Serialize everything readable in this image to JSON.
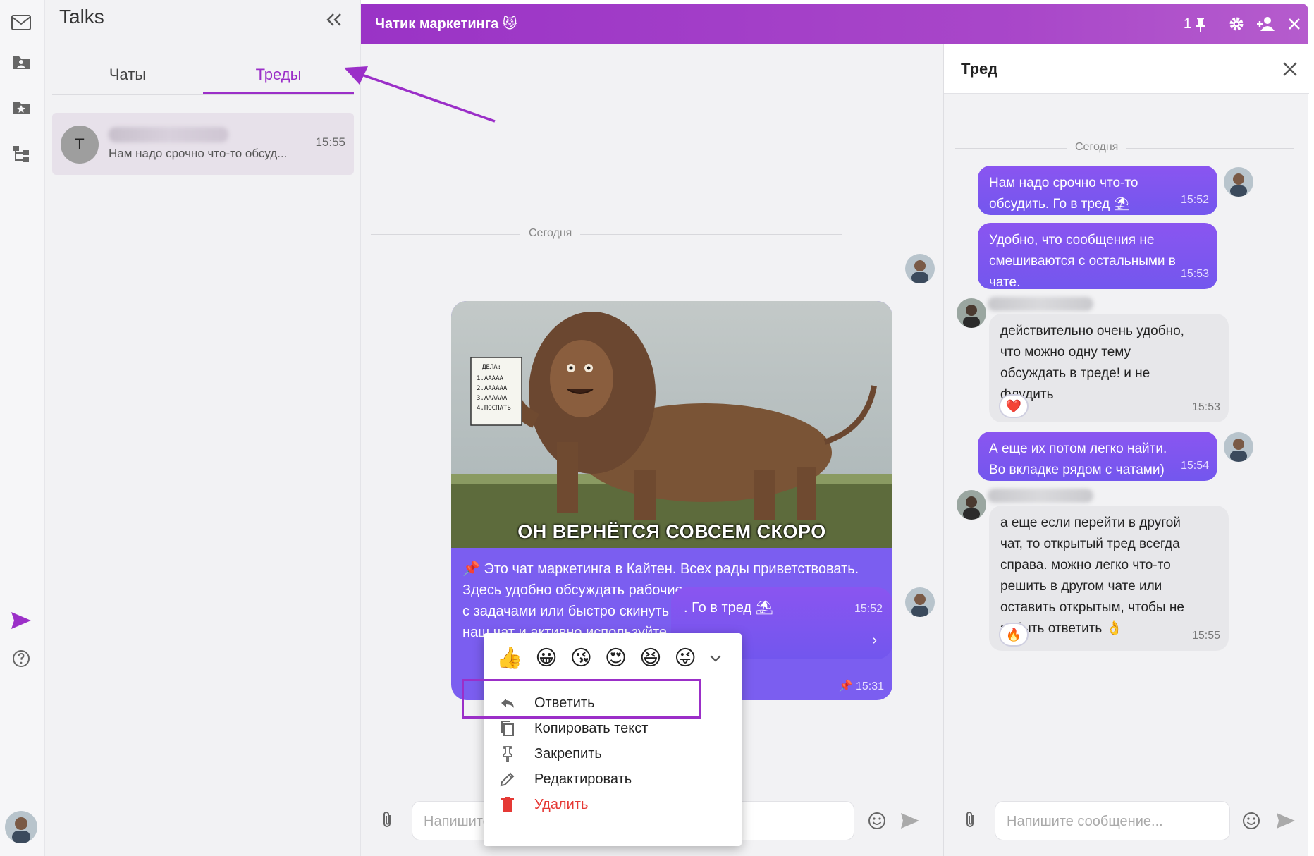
{
  "sidebar": {
    "title": "Talks",
    "tabs": [
      {
        "label": "Чаты"
      },
      {
        "label": "Треды"
      }
    ],
    "thread_item": {
      "avatar_letter": "T",
      "preview": "Нам надо срочно что-то обсуд...",
      "time": "15:55"
    }
  },
  "header": {
    "title": "Чатик маркетинга 😼",
    "pinned_count": "1"
  },
  "chat": {
    "date_label": "Сегодня",
    "meme_caption": "ОН ВЕРНЁТСЯ СОВСЕМ СКОРО",
    "note_lines": [
      "ДЕЛА:",
      "1.ААААА",
      "2.АААААА",
      "3.АААААА",
      "4.ПОСПАТЬ"
    ],
    "message1": {
      "text": "📌 Это чат маркетинга в Кайтен. Всех рады приветствовать. Здесь удобно обсуждать рабочие процессы не отходя от досок с задачами или быстро скинуть файл. Добавляйте коллег в наш чат и активно используйте",
      "time": "15:31"
    },
    "message2": {
      "text": ". Го в тред ⛱",
      "time": "15:52"
    },
    "input_placeholder": "Напишите сообщение..."
  },
  "context_menu": {
    "emojis": [
      "👍",
      "😀",
      "😘",
      "😍",
      "😆",
      "😜"
    ],
    "items": [
      {
        "label": "Ответить"
      },
      {
        "label": "Копировать текст"
      },
      {
        "label": "Закрепить"
      },
      {
        "label": "Редактировать"
      },
      {
        "label": "Удалить"
      }
    ]
  },
  "thread": {
    "title": "Тред",
    "date_label": "Сегодня",
    "messages": [
      {
        "text": "Нам надо срочно что-то обсудить. Го в тред ⛱",
        "time": "15:52"
      },
      {
        "text": "Удобно, что сообщения не смешиваются с остальными в чате.",
        "time": "15:53"
      },
      {
        "text": "действительно очень удобно, что можно одну тему обсуждать в треде! и не флудить",
        "time": "15:53",
        "reaction": "❤️"
      },
      {
        "text": "А еще их потом легко найти. Во вкладке рядом с чатами)",
        "time": "15:54"
      },
      {
        "text": "а еще если перейти в другой чат, то открытый тред всегда справа. можно легко что-то решить в другом чате или оставить открытым, чтобы не забыть ответить 👌",
        "time": "15:55",
        "reaction": "🔥"
      }
    ],
    "input_placeholder": "Напишите сообщение..."
  },
  "colors": {
    "accent": "#9b2fc8",
    "bubble": "#7b5ef0",
    "danger": "#e53935"
  }
}
